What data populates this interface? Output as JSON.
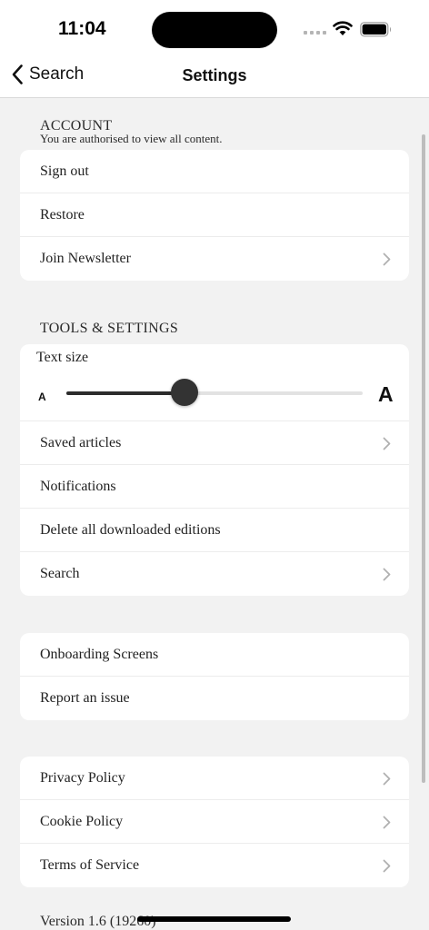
{
  "status_bar": {
    "time": "11:04"
  },
  "nav": {
    "back_label": "Search",
    "title": "Settings"
  },
  "account": {
    "title": "ACCOUNT",
    "subtitle": "You are authorised to view all content.",
    "items": [
      {
        "label": "Sign out",
        "chevron": false
      },
      {
        "label": "Restore",
        "chevron": false
      },
      {
        "label": "Join Newsletter",
        "chevron": true
      }
    ]
  },
  "tools": {
    "title": "TOOLS & SETTINGS",
    "text_size": {
      "label": "Text size",
      "small_glyph": "A",
      "large_glyph": "A",
      "value": 0.4
    },
    "items": [
      {
        "label": "Saved articles",
        "chevron": true
      },
      {
        "label": "Notifications",
        "chevron": false
      },
      {
        "label": "Delete all downloaded editions",
        "chevron": false
      },
      {
        "label": "Search",
        "chevron": true
      }
    ]
  },
  "support": {
    "items": [
      {
        "label": "Onboarding Screens",
        "chevron": false
      },
      {
        "label": "Report an issue",
        "chevron": false
      }
    ]
  },
  "legal": {
    "items": [
      {
        "label": "Privacy Policy",
        "chevron": true
      },
      {
        "label": "Cookie Policy",
        "chevron": true
      },
      {
        "label": "Terms of Service",
        "chevron": true
      }
    ]
  },
  "version": "Version 1.6 (19260)"
}
